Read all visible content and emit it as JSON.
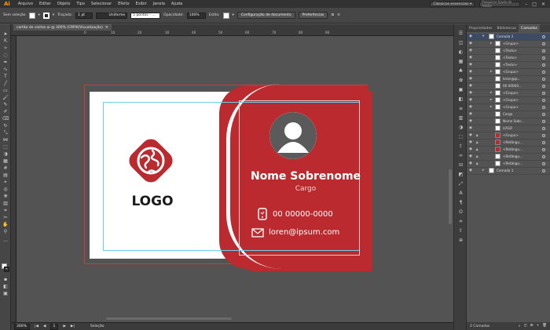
{
  "app": {
    "logo": "Ai"
  },
  "menu": [
    "Arquivo",
    "Editar",
    "Objeto",
    "Tipo",
    "Selecionar",
    "Efeito",
    "Exibir",
    "Janela",
    "Ajuda"
  ],
  "workspace": "Clássicos essenciais",
  "search_placeholder": "Pesquisar Ajuda do Adobe",
  "control": {
    "selection": "Sem seleção",
    "stroke_label": "Traçado:",
    "stroke_value": "1 pt",
    "uniform": "Uniforme",
    "brush": "5 pontos - ...",
    "opacity_label": "Opacidade:",
    "opacity_value": "100%",
    "style_label": "Estilo:",
    "doc_setup": "Configuração de documento",
    "prefs": "Preferências"
  },
  "document_tab": "cartão de visitas.ai @ 300% (CMYK/Visualização)",
  "ruler_labels": [
    "0",
    "10",
    "20",
    "30",
    "40",
    "50",
    "60",
    "70",
    "80",
    "90"
  ],
  "statusbar": {
    "zoom": "300%",
    "page": "1",
    "tool": "Seleção"
  },
  "panel_tabs": [
    "Propriedades",
    "Bibliotecas",
    "Camadas"
  ],
  "layers": [
    {
      "name": "Camada 2",
      "kind": "layer"
    },
    {
      "name": "<Grupo>",
      "kind": "group"
    },
    {
      "name": "<Texto>",
      "kind": "item"
    },
    {
      "name": "<Texto>",
      "kind": "item"
    },
    {
      "name": "<Texto>",
      "kind": "item"
    },
    {
      "name": "<Grupo>",
      "kind": "group"
    },
    {
      "name": "loren@ip...",
      "kind": "item"
    },
    {
      "name": "00 00000...",
      "kind": "item"
    },
    {
      "name": "<Grupo>",
      "kind": "group"
    },
    {
      "name": "<Grupo>",
      "kind": "group"
    },
    {
      "name": "<Grupo>",
      "kind": "group"
    },
    {
      "name": "Cargo",
      "kind": "item"
    },
    {
      "name": "Nome Sobr...",
      "kind": "item"
    },
    {
      "name": "LOGO",
      "kind": "item"
    },
    {
      "name": "<Grupo>",
      "kind": "item"
    },
    {
      "name": "<Retângu...",
      "kind": "item"
    },
    {
      "name": "<Retângu...",
      "kind": "item"
    },
    {
      "name": "<Retângu...",
      "kind": "item"
    },
    {
      "name": "<Retângu...",
      "kind": "item"
    },
    {
      "name": "Camada 1",
      "kind": "layer"
    }
  ],
  "panel_footer": "2 Camadas",
  "card": {
    "logo_text": "LOGO",
    "name": "Nome Sobrenome",
    "title": "Cargo",
    "phone": "00 00000-0000",
    "email": "loren@ipsum.com",
    "accent_color": "#bb2a2e"
  }
}
